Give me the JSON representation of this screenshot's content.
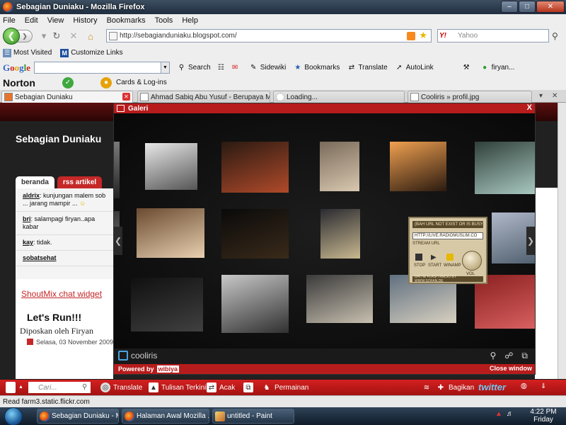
{
  "window": {
    "title": "Sebagian Duniaku - Mozilla Firefox"
  },
  "menu": [
    "File",
    "Edit",
    "View",
    "History",
    "Bookmarks",
    "Tools",
    "Help"
  ],
  "nav": {
    "url": "http://sebagianduniaku.blogspot.com/",
    "search_placeholder": "Yahoo",
    "search_engine": "Y!"
  },
  "bookmarks": [
    "Most Visited",
    "Customize Links"
  ],
  "googlebar": {
    "logo": "Google",
    "items": [
      "Search",
      "Sidewiki",
      "Bookmarks",
      "Translate",
      "AutoLink",
      "firyan..."
    ]
  },
  "nortonbar": {
    "logo": "Norton",
    "cards": "Cards & Log-ins"
  },
  "tabs": [
    {
      "label": "Sebagian Duniaku",
      "active": true
    },
    {
      "label": "Ahmad Sabiq Abu Yusuf - Berupaya M...",
      "active": false
    },
    {
      "label": "Loading...",
      "active": false
    },
    {
      "label": "Cooliris » profil.jpg",
      "active": false
    }
  ],
  "page": {
    "blog_title": "Sebagian Duniaku",
    "tabs": [
      "beranda",
      "rss artikel"
    ],
    "shouts": [
      {
        "name": "aldrix",
        "text": "kunjungan malem sob ... jarang mampir ..."
      },
      {
        "name": "bri",
        "text": "salampagi firyan..apa kabar"
      },
      {
        "name": "kay",
        "text": "tidak."
      },
      {
        "name": "sobatsehat",
        "text": ""
      }
    ],
    "shout_link": "ShoutMix chat widget",
    "post_title": "Let's Run!!!",
    "post_by": "Diposkan oleh Firyan",
    "post_date": "Selasa, 03 November 2009"
  },
  "gallery": {
    "title": "Galeri",
    "close": "X",
    "brand": "cooliris",
    "powered_by": "Powered by",
    "wibiya": "wibiya",
    "close_window": "Close window",
    "thumbs": [
      {
        "color_a": "#e8e8e8",
        "color_b": "#555555"
      },
      {
        "color_a": "#2a1a12",
        "color_b": "#b04a2a"
      },
      {
        "color_a": "#7a6a5a",
        "color_b": "#d8c8b0"
      },
      {
        "color_a": "#f0a050",
        "color_b": "#2a1a10"
      },
      {
        "color_a": "#30403a",
        "color_b": "#a8c8c0"
      },
      {
        "color_a": "#6a4a30",
        "color_b": "#e8d0b0"
      },
      {
        "color_a": "#0a0a0a",
        "color_b": "#3a2a1a"
      },
      {
        "color_a": "#2a2a30",
        "color_b": "#c8b890"
      },
      {
        "color_a": "#b0b8c8",
        "color_b": "#506070"
      },
      {
        "color_a": "#101010",
        "color_b": "#404040"
      },
      {
        "color_a": "#c8c8c8",
        "color_b": "#303030"
      },
      {
        "color_a": "#3a3a3a",
        "color_b": "#c8c0b0"
      },
      {
        "color_a": "#607080",
        "color_b": "#d8d0c0"
      },
      {
        "color_a": "#8a2020",
        "color_b": "#d86060"
      }
    ],
    "radio": {
      "top": "(BAH URL NOT EXIST OR IS BUSY",
      "url": "HTTP://LIVE.RADIOMUSLIM.CO",
      "stream": "STREAM URL",
      "stop": "STOP",
      "start": "START",
      "winamp": "WINAMP",
      "vol": "VOL",
      "foot": "BATHE FLASH RADIO BY WWW.SOFAN.DE"
    }
  },
  "wibiyabar": {
    "search_placeholder": "Cari...",
    "items": [
      "Translate",
      "Tulisan Terkini",
      "Acak",
      "Permainan",
      "Bagikan"
    ],
    "twitter": "twitter"
  },
  "status": "Read farm3.static.flickr.com",
  "taskbar": {
    "tasks": [
      "Sebagian Duniaku - M...",
      "Halaman Awal Mozilla ...",
      "untitled - Paint"
    ],
    "time": "4:22 PM",
    "day": "Friday"
  }
}
